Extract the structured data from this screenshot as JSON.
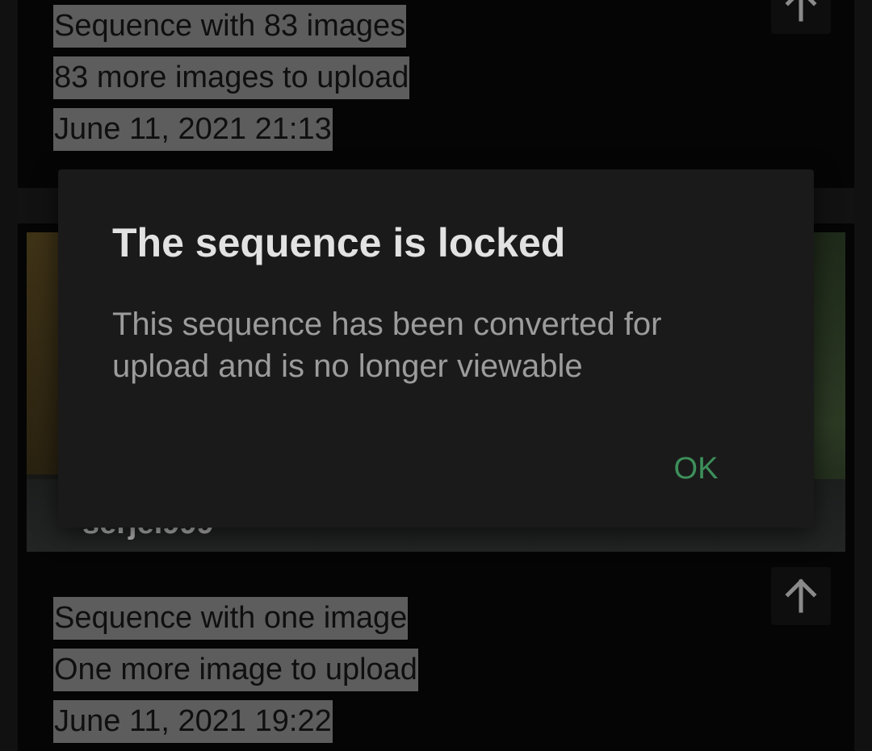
{
  "sequences": [
    {
      "title": "Sequence with 83 images",
      "pending": "83 more images to upload",
      "date": "June 11, 2021 21:13",
      "upload_icon": "arrow-up-icon"
    },
    {
      "author": "serjel999",
      "title": "Sequence with one image",
      "pending": "One more image to upload",
      "date": "June 11, 2021 19:22",
      "upload_icon": "arrow-up-icon"
    }
  ],
  "dialog": {
    "title": "The sequence is locked",
    "message": "This sequence has been converted for upload and is no longer viewable",
    "ok_label": "OK"
  },
  "colors": {
    "dialog_background": "#1a1a1a",
    "accent_ok": "#3d8f5a",
    "title_text": "#e2e2e2",
    "message_text": "#9c9c9c"
  }
}
